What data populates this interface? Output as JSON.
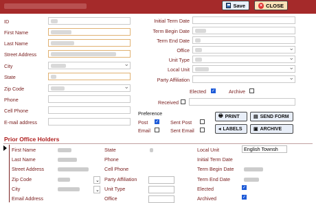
{
  "toolbar": {
    "save_label": "Save",
    "close_label": "CLOSE"
  },
  "left_labels": [
    "ID",
    "First Name",
    "Last Name",
    "Street Address",
    "City",
    "State",
    "Zip Code",
    "Phone",
    "Cell Phone",
    "E-mail address"
  ],
  "right_labels": [
    "Initial Term Date",
    "Term Begin Date",
    "Term End Date",
    "Office",
    "Unit Type",
    "Local Unit",
    "Party Affiliation"
  ],
  "flags": {
    "elected_label": "Elected",
    "elected": true,
    "archive_label": "Archive",
    "archive": false,
    "received_label": "Received",
    "received": false
  },
  "preference": {
    "title": "Preference",
    "post_label": "Post",
    "post": true,
    "email_label": "Email",
    "email": false,
    "sent_post_label": "Sent Post",
    "sent_post": false,
    "sent_email_label": "Sent Email",
    "sent_email": false
  },
  "actions": {
    "print": "PRINT",
    "send_form": "SEND FORM",
    "labels": "LABELS",
    "archive": "ARCHIVE"
  },
  "prior": {
    "title": "Prior Office Holders",
    "col1": [
      "First Name",
      "Last Name",
      "Street Address",
      "Zip Code",
      "City",
      "Email Address"
    ],
    "col2": [
      "State",
      "Phone",
      "Cell Phone",
      "Party Affiliation",
      "Unit Type",
      "Office"
    ],
    "col3": [
      "Local Unit",
      "Initial Term Date",
      "Term Begin Date",
      "Term End Date",
      "Elected",
      "Archived"
    ],
    "local_unit_value": "English Townsh",
    "elected": true,
    "archived": true
  }
}
